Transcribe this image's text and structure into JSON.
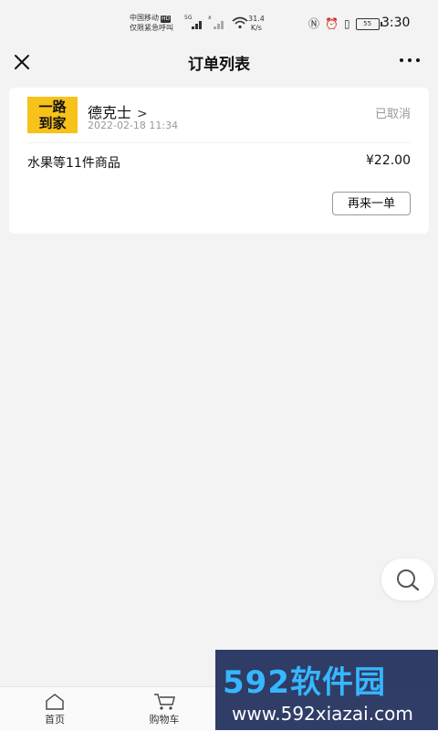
{
  "status_bar": {
    "carrier_line1": "中国移动",
    "carrier_hd": "HD",
    "carrier_line2": "仅限紧急呼叫",
    "signal1_label": "5G",
    "signal2_label": "x",
    "speed_value": "31.4",
    "speed_unit": "K/s",
    "battery": "55",
    "time": "3:30"
  },
  "navbar": {
    "title": "订单列表",
    "close_icon": "close-icon",
    "more_icon": "more-icon"
  },
  "order": {
    "logo_line1": "一路",
    "logo_line2": "到家",
    "store_name": "德克士",
    "chevron": ">",
    "time": "2022-02-18 11:34",
    "status": "已取消",
    "goods_summary": "水果等11件商品",
    "price": "¥22.00",
    "reorder_label": "再来一单",
    "colors": {
      "logo_bg": "#f7c21a",
      "status": "#999999"
    }
  },
  "tabbar": {
    "items": [
      {
        "label": "首页",
        "icon": "home-icon"
      },
      {
        "label": "购物车",
        "icon": "cart-icon"
      }
    ]
  },
  "watermark": {
    "brand": "592软件园",
    "url": "www.592xiazai.com"
  }
}
